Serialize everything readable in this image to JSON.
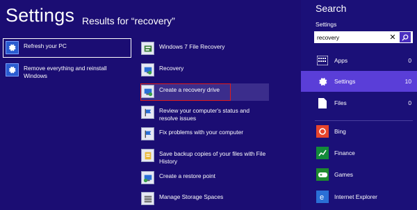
{
  "header": {
    "title": "Settings",
    "results": "Results for “recovery”"
  },
  "left_results": [
    {
      "label": "Refresh your PC"
    },
    {
      "label": "Remove everything and reinstall Windows"
    }
  ],
  "mid_results": [
    {
      "label": "Windows 7 File Recovery"
    },
    {
      "label": "Recovery"
    },
    {
      "label": "Create a recovery drive"
    },
    {
      "label": "Review your computer's status and resolve issues"
    },
    {
      "label": "Fix problems with your computer"
    },
    {
      "label": "Save backup copies of your files with File History"
    },
    {
      "label": "Create a restore point"
    },
    {
      "label": "Manage Storage Spaces"
    }
  ],
  "search": {
    "title": "Search",
    "scope": "Settings",
    "query": "recovery",
    "categories": [
      {
        "label": "Apps",
        "count": "0"
      },
      {
        "label": "Settings",
        "count": "10"
      },
      {
        "label": "Files",
        "count": "0"
      }
    ],
    "apps": [
      {
        "label": "Bing",
        "color": "#e8452c"
      },
      {
        "label": "Finance",
        "color": "#128a3a"
      },
      {
        "label": "Games",
        "color": "#1e8a2e"
      },
      {
        "label": "Internet Explorer",
        "color": "#2a6fd6"
      }
    ]
  },
  "colors": {
    "background": "#1b0d73",
    "accent": "#5a3ed8",
    "highlight_border": "#e01a1a"
  }
}
